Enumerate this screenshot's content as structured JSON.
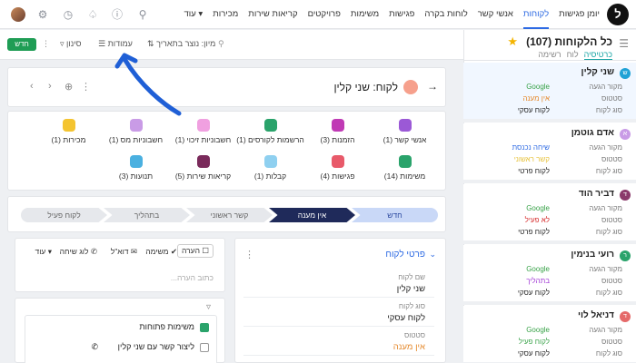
{
  "nav": {
    "links": [
      "יומן פגישות",
      "לקוחות",
      "אנשי קשר",
      "לוחות בקרה",
      "פגישות",
      "משימות",
      "פרויקטים",
      "קריאות שירות",
      "מכירות",
      "עוד"
    ],
    "active_index": 1,
    "logo_glyph": "ל"
  },
  "list": {
    "title": "כל הלקוחות (107)",
    "views": [
      "כרטיסיה",
      "לוח",
      "רשימה"
    ],
    "active_view": 0,
    "cards": [
      {
        "initial": "ש",
        "name": "שני קלין",
        "color": "#1fa2d6",
        "rows": [
          [
            "מקור הגעה",
            "Google",
            "#3aa34a"
          ],
          [
            "סטטוס",
            "אין מענה",
            "#e5892c"
          ],
          [
            "סוג לקוח",
            "לקוח עסקי",
            "#222"
          ]
        ]
      },
      {
        "initial": "א",
        "name": "אדם גוטמן",
        "color": "#c99be6",
        "rows": [
          [
            "מקור הגעה",
            "שיחה נכנסת",
            "#2d6ae3"
          ],
          [
            "סטטוס",
            "קשר ראשוני",
            "#e7c23c"
          ],
          [
            "סוג לקוח",
            "לקוח פרטי",
            "#222"
          ]
        ]
      },
      {
        "initial": "ד",
        "name": "דביר הוד",
        "color": "#8a3a6b",
        "rows": [
          [
            "מקור הגעה",
            "Google",
            "#3aa34a"
          ],
          [
            "סטטוס",
            "לא פעיל",
            "#d62b2b"
          ],
          [
            "סוג לקוח",
            "לקוח פרטי",
            "#222"
          ]
        ]
      },
      {
        "initial": "ר",
        "name": "רועי בנימין",
        "color": "#2aa36b",
        "rows": [
          [
            "מקור הגעה",
            "Google",
            "#3aa34a"
          ],
          [
            "סטטוס",
            "בתהליך",
            "#a23ad6"
          ],
          [
            "סוג לקוח",
            "לקוח עסקי",
            "#222"
          ]
        ]
      },
      {
        "initial": "ד",
        "name": "דניאל לוי",
        "color": "#e56a6a",
        "rows": [
          [
            "מקור הגעה",
            "Google",
            "#3aa34a"
          ],
          [
            "סטטוס",
            "לקוח פעיל",
            "#3aa34a"
          ],
          [
            "סוג לקוח",
            "לקוח עסקי",
            "#222"
          ]
        ]
      }
    ]
  },
  "toolbar": {
    "new_label": "חדש",
    "filter_label": "סינון",
    "columns_label": "עמודות",
    "sort_label": "מיון: נוצר בתאריך"
  },
  "record": {
    "title": "לקוח: שני קלין"
  },
  "related": [
    {
      "label": "אנשי קשר (1)",
      "color": "#9b59d6"
    },
    {
      "label": "הזמנות (3)",
      "color": "#c03ab5"
    },
    {
      "label": "הרשמות לקורסים (1)",
      "color": "#2aa36b"
    },
    {
      "label": "חשבוניות זיכוי (1)",
      "color": "#f0a0e0"
    },
    {
      "label": "חשבוניות מס (1)",
      "color": "#c99be6"
    },
    {
      "label": "מכירות (1)",
      "color": "#f4c430"
    },
    {
      "label": "משימות (14)",
      "color": "#2aa36b"
    },
    {
      "label": "פגישות (4)",
      "color": "#e85a6a"
    },
    {
      "label": "קבלות (1)",
      "color": "#8fd0f0"
    },
    {
      "label": "קריאות שירות (5)",
      "color": "#7a2a5b"
    },
    {
      "label": "תנועות (3)",
      "color": "#4ab0e0"
    }
  ],
  "stages": [
    "חדש",
    "אין מענה",
    "קשר ראשוני",
    "בתהליך",
    "לקוח פעיל"
  ],
  "current_stage": 1,
  "details": {
    "title": "פרטי לקוח",
    "fields": [
      {
        "label": "שם לקוח",
        "value": "שני קלין",
        "color": "#222"
      },
      {
        "label": "סוג לקוח",
        "value": "לקוח עסקי",
        "color": "#222"
      },
      {
        "label": "סטטוס",
        "value": "אין מענה",
        "color": "#e5892c"
      }
    ]
  },
  "activity": {
    "tabs": [
      "הערה",
      "משימה",
      "דוא\"ל",
      "לוג שיחה",
      "עוד"
    ],
    "placeholder": "כתוב הערה..."
  },
  "tasks": {
    "header": "משימות פתוחות",
    "items": [
      "ליצור קשר עם שני קלין"
    ]
  }
}
